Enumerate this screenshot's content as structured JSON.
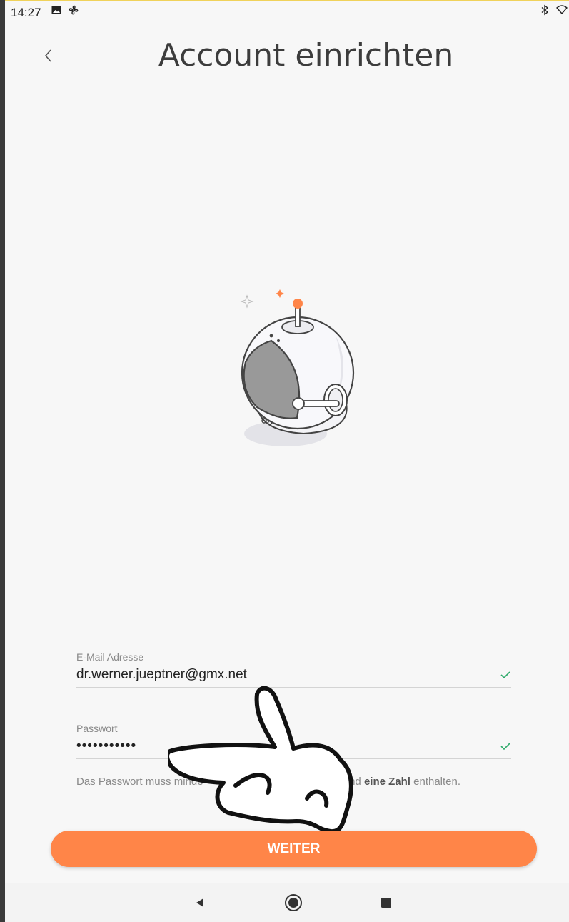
{
  "status_bar": {
    "time": "14:27"
  },
  "header": {
    "title": "Account einrichten"
  },
  "form": {
    "email": {
      "label": "E-Mail Adresse",
      "value": "dr.werner.jueptner@gmx.net"
    },
    "password": {
      "label": "Passwort",
      "value": "•••••••••••"
    },
    "hint": {
      "part1": "Das Passwort muss minde",
      "part2": " und ",
      "bold": "eine Zahl",
      "part3": " enthalten."
    }
  },
  "button": {
    "label": "WEITER"
  },
  "colors": {
    "accent": "#ff8548",
    "valid_check": "#2eaa6a",
    "background": "#f7f7f7"
  },
  "icons": {
    "status": [
      "image-icon",
      "fan-icon",
      "bluetooth-icon",
      "wifi-icon"
    ],
    "nav": [
      "back-triangle-icon",
      "home-circle-icon",
      "recents-square-icon"
    ]
  }
}
